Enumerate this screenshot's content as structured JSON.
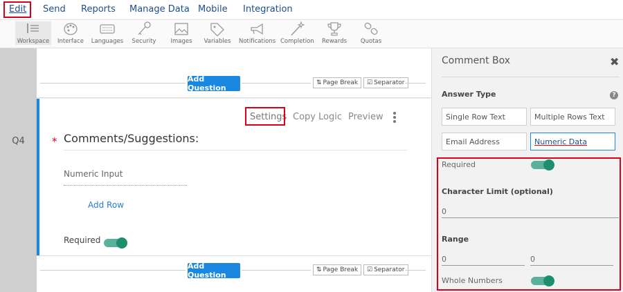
{
  "menu": {
    "items": [
      "Edit",
      "Send",
      "Reports",
      "Manage Data",
      "Mobile",
      "Integration"
    ]
  },
  "toolbar": {
    "items": [
      {
        "label": "Workspace",
        "icon": "workspace-icon"
      },
      {
        "label": "Interface",
        "icon": "palette-icon"
      },
      {
        "label": "Languages",
        "icon": "keyboard-icon"
      },
      {
        "label": "Security",
        "icon": "key-icon"
      },
      {
        "label": "Images",
        "icon": "image-icon"
      },
      {
        "label": "Variables",
        "icon": "tag-icon"
      },
      {
        "label": "Notifications",
        "icon": "megaphone-icon"
      },
      {
        "label": "Completion",
        "icon": "wand-icon"
      },
      {
        "label": "Rewards",
        "icon": "trophy-icon"
      },
      {
        "label": "Quotas",
        "icon": "link-icon"
      }
    ]
  },
  "gutter": {
    "q4": "Q4"
  },
  "canvas": {
    "add_question": "Add Question",
    "page_break": "Page Break",
    "separator": "Separator"
  },
  "question": {
    "actions": {
      "settings": "Settings",
      "copy": "Copy",
      "logic": "Logic",
      "preview": "Preview"
    },
    "required_star": "*",
    "title": "Comments/Suggestions:",
    "input_placeholder": "Numeric Input",
    "add_row": "Add Row",
    "required_label": "Required",
    "required_on": true
  },
  "right_panel": {
    "title": "Comment Box",
    "close": "✖",
    "answer_type_label": "Answer Type",
    "help": "?",
    "options": [
      "Single Row Text",
      "Multiple Rows Text",
      "Email Address",
      "Numeric Data"
    ],
    "selected_option": "Numeric Data",
    "required_label": "Required",
    "character_limit_label": "Character Limit (optional)",
    "character_limit_value": "0",
    "range_label": "Range",
    "range_min": "0",
    "range_max": "0",
    "whole_numbers_label": "Whole Numbers"
  },
  "colors": {
    "accent": "#1a88e0",
    "highlight": "#d9001b",
    "toggle": "#1c8f6e",
    "menu_text": "#1d4e8f"
  }
}
